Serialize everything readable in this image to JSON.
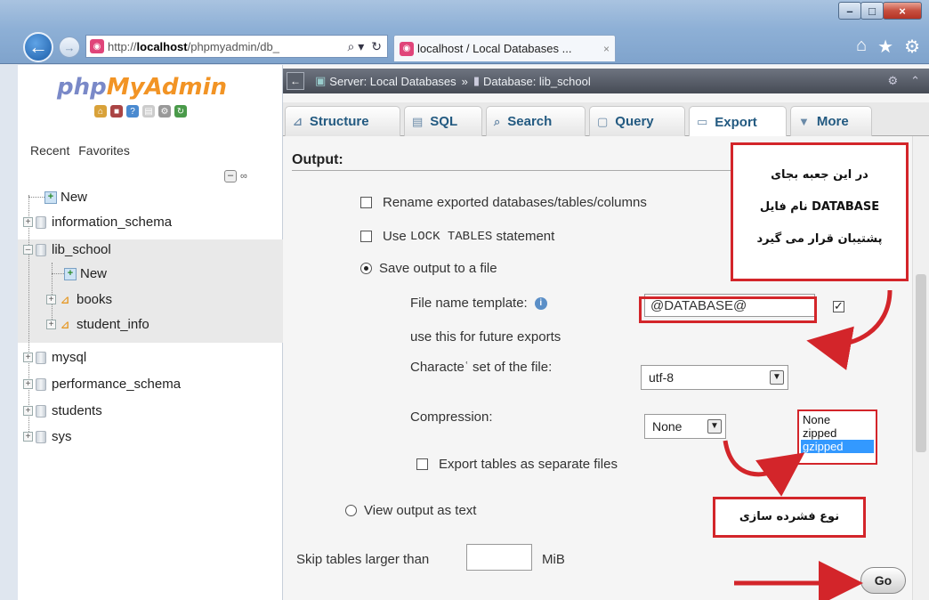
{
  "browser": {
    "url_prefix": "http://",
    "url_host": "localhost",
    "url_rest": "/phpmyadmin/db_",
    "search_glyph": "⌕ ▾",
    "refresh_glyph": "↻",
    "tab_title": "localhost / Local Databases ...",
    "tab_close": "×",
    "window_minimize": "–",
    "window_maximize": "□",
    "window_close": "×",
    "back_glyph": "←",
    "forward_glyph": "→",
    "home_icon": "⌂",
    "favorites_icon": "★",
    "settings_icon": "⚙"
  },
  "sidebar": {
    "logo_php": "php",
    "logo_myadmin": "MyAdmin",
    "recent": "Recent",
    "favorites": "Favorites",
    "tree": [
      {
        "label": "New"
      },
      {
        "label": "information_schema"
      },
      {
        "label": "lib_school"
      },
      {
        "label": "New"
      },
      {
        "label": "books"
      },
      {
        "label": "student_info"
      },
      {
        "label": "mysql"
      },
      {
        "label": "performance_schema"
      },
      {
        "label": "students"
      },
      {
        "label": "sys"
      }
    ]
  },
  "breadcrumb": {
    "server": "Server: Local Databases",
    "separator": "»",
    "database": "Database: lib_school"
  },
  "tabs": [
    {
      "label": "Structure"
    },
    {
      "label": "SQL"
    },
    {
      "label": "Search"
    },
    {
      "label": "Query"
    },
    {
      "label": "Export"
    },
    {
      "label": "More"
    }
  ],
  "output": {
    "heading": "Output:",
    "rename_label": "Rename exported databases/tables/columns",
    "lock_use": "Use",
    "lock_code": "LOCK TABLES",
    "lock_statement": "statement",
    "save_to_file": "Save output to a file",
    "file_name_label": "File name template:",
    "file_name_value": "@DATABASE@",
    "future_exports": "use this for future exports",
    "charset_label": "Characteʿ set of the file:",
    "charset_value": "utf-8",
    "compression_label": "Compression:",
    "compression_value": "None",
    "compression_options": [
      "None",
      "zipped",
      "gzipped"
    ],
    "separate_files": "Export tables as separate files",
    "view_as_text": "View output as text",
    "skip_label": "Skip tables larger than",
    "skip_unit": "MiB",
    "go_button": "Go"
  },
  "annotations": {
    "top_line1": "در این جعبه بجای",
    "top_line2": "DATABASE نام فایل",
    "top_line3": "پشتیبان قرار می گیرد",
    "bottom": "نوع فشرده سازی"
  },
  "colors": {
    "annotation_red": "#d3252a",
    "tab_text": "#235a81",
    "logo_orange": "#f29425",
    "logo_blue": "#7a89c8",
    "highlight_blue": "#3399ff"
  }
}
